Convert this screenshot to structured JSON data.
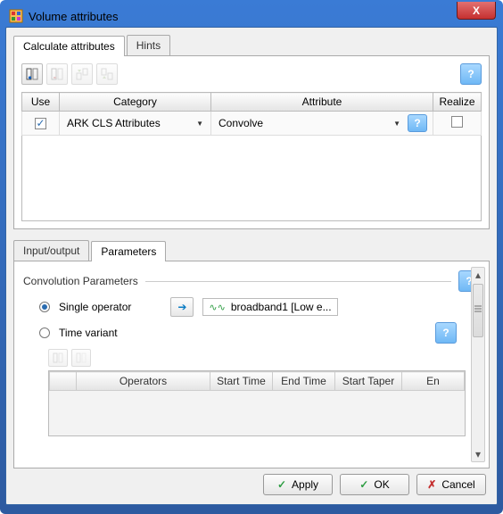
{
  "window": {
    "title": "Volume attributes"
  },
  "tabs": {
    "calculate": "Calculate attributes",
    "hints": "Hints"
  },
  "toolbar_icons": {
    "add": "add-column-icon",
    "remove": "remove-column-icon",
    "move_up": "move-up-icon",
    "move_down": "move-down-icon"
  },
  "grid": {
    "headers": {
      "use": "Use",
      "category": "Category",
      "attribute": "Attribute",
      "realize": "Realize"
    },
    "row": {
      "use_checked": "✓",
      "category": "ARK CLS Attributes",
      "attribute": "Convolve"
    }
  },
  "subtabs": {
    "io": "Input/output",
    "params": "Parameters"
  },
  "conv": {
    "group": "Convolution Parameters",
    "single": "Single operator",
    "time": "Time variant",
    "operator_display": "broadband1 [Low e...",
    "ops_headers": {
      "blank": "",
      "operators": "Operators",
      "start_time": "Start Time",
      "end_time": "End Time",
      "start_taper": "Start Taper",
      "end_taper": "En"
    }
  },
  "buttons": {
    "apply": "Apply",
    "ok": "OK",
    "cancel": "Cancel"
  },
  "glyphs": {
    "help": "?",
    "close": "X",
    "chev_down": "▼",
    "arrow_right": "➔",
    "up": "▴",
    "down": "▾"
  }
}
